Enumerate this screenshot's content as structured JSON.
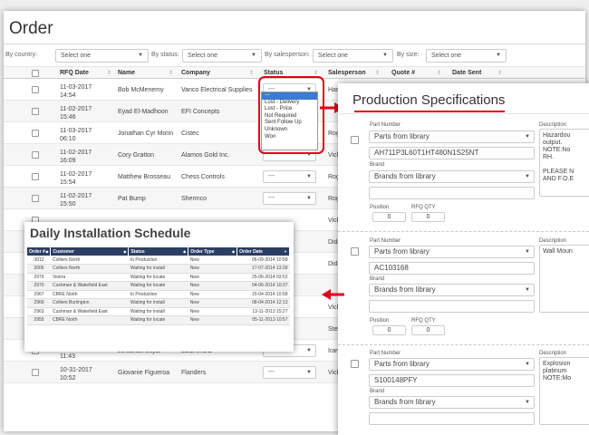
{
  "order": {
    "title": "Order",
    "filters": {
      "country_label": "By country:",
      "country_value": "Select one",
      "status_label": "By status:",
      "status_value": "Select one",
      "salesperson_label": "By salesperson:",
      "salesperson_value": "Select one",
      "size_label": "By size:",
      "size_value": "Select one"
    },
    "columns": [
      "RFQ Date",
      "Name",
      "Company",
      "Status",
      "Salesperson",
      "Quote #",
      "Date Sent"
    ],
    "rows": [
      {
        "date": "11-03-2017 14:54",
        "name": "Bob McMenemy",
        "company": "Vanco Electrical Supplies",
        "status": "---",
        "salesperson": "Hard"
      },
      {
        "date": "11-02-2017 15:46",
        "name": "Eyad El-Madhoon",
        "company": "EFI Concepts",
        "status": "",
        "salesperson": ""
      },
      {
        "date": "11-03-2017 06:10",
        "name": "Jonathan Cyr Morin",
        "company": "Cistec",
        "status": "",
        "salesperson": "Roge"
      },
      {
        "date": "11-02-2017 16:09",
        "name": "Cory Gratton",
        "company": "Alamos Gold Inc.",
        "status": "---",
        "salesperson": "Vick"
      },
      {
        "date": "11-02-2017 15:54",
        "name": "Matthew Brosseau",
        "company": "Chess Controls",
        "status": "---",
        "salesperson": "Roge"
      },
      {
        "date": "11-02-2017 15:50",
        "name": "Pat Bump",
        "company": "Shermco",
        "status": "---",
        "salesperson": "Roge"
      },
      {
        "date": "",
        "name": "",
        "company": "",
        "status": "",
        "salesperson": "Vick"
      },
      {
        "date": "",
        "name": "",
        "company": "",
        "status": "",
        "salesperson": "Dida"
      },
      {
        "date": "",
        "name": "",
        "company": "",
        "status": "",
        "salesperson": "Dida"
      },
      {
        "date": "",
        "name": "",
        "company": "",
        "status": "",
        "salesperson": ""
      },
      {
        "date": "",
        "name": "",
        "company": "",
        "status": "",
        "salesperson": "Vick"
      },
      {
        "date": "",
        "name": "",
        "company": "",
        "status": "",
        "salesperson": "Steve"
      },
      {
        "date": "11-01-2017 11:43",
        "name": "Jonathan Joyal",
        "company": "ELCARGO",
        "status": "---",
        "salesperson": "Iran"
      },
      {
        "date": "10-31-2017 10:52",
        "name": "Giovanie Figueroa",
        "company": "Flanders",
        "status": "---",
        "salesperson": "Vick"
      }
    ]
  },
  "status_dropdown": {
    "options": [
      "---",
      "Lost - Delivery",
      "Lost - Price",
      "Not Required",
      "Sent Follow Up",
      "Unknown",
      "Won"
    ]
  },
  "production": {
    "title": "Production Specifications",
    "part_number_label": "Part Number",
    "brand_label": "Brand",
    "description_label": "Description",
    "position_label": "Position",
    "rfq_qty_label": "RFQ QTY",
    "items": [
      {
        "part_select": "Parts from library",
        "part_number": "AH711P3L60T1HT480N1S25NT",
        "brand_select": "Brands from library",
        "brand": "",
        "position": "0",
        "rfq_qty": "0",
        "description": "Hazardou\noutput.\nNOTE:No\nRH.\n\nPLEASE N\nAND F.O.E"
      },
      {
        "part_select": "Parts from library",
        "part_number": "AC103168",
        "brand_select": "Brands from library",
        "brand": "",
        "position": "0",
        "rfq_qty": "0",
        "description": "Wall Moun"
      },
      {
        "part_select": "Parts from library",
        "part_number": "S100148PFY",
        "brand_select": "Brands from library",
        "brand": "",
        "description": "Explosion\nplatinum\nNOTE:Mo"
      }
    ]
  },
  "daily": {
    "title": "Daily Installation Schedule",
    "columns": [
      "Order #",
      "Customer",
      "Status",
      "Order Type",
      "Order Date"
    ],
    "rows": [
      [
        "3012",
        "Colliers North",
        "In Production",
        "New",
        "06-09-2014 10:58"
      ],
      [
        "3006",
        "Colliers North",
        "Waiting for install",
        "New",
        "17-07-2014 13:39"
      ],
      [
        "2979",
        "Vestra",
        "Waiting for locate",
        "New",
        "25-06-2014 03:52"
      ],
      [
        "2970",
        "Cushman & Wakefield East",
        "Waiting for locate",
        "New",
        "04-06-2014 10:37"
      ],
      [
        "2967",
        "CBRE North",
        "In Production",
        "New",
        "15-04-2014 10:58"
      ],
      [
        "2966",
        "Colliers Burlington",
        "Waiting for install",
        "New",
        "08-04-2014 12:13"
      ],
      [
        "2963",
        "Cushman & Wakefield East",
        "Waiting for install",
        "New",
        "13-11-2013 15:27"
      ],
      [
        "2955",
        "CBRE North",
        "Waiting for locate",
        "New",
        "05-11-2013 10:57"
      ]
    ]
  },
  "colors": {
    "accent_red": "#e3001b",
    "table_header": "#2c3e63",
    "select_highlight": "#3a7bd5"
  },
  "icons": {
    "caret": "chevron-down-icon",
    "sort": "sort-icon",
    "arrow": "red-arrow-icon"
  }
}
